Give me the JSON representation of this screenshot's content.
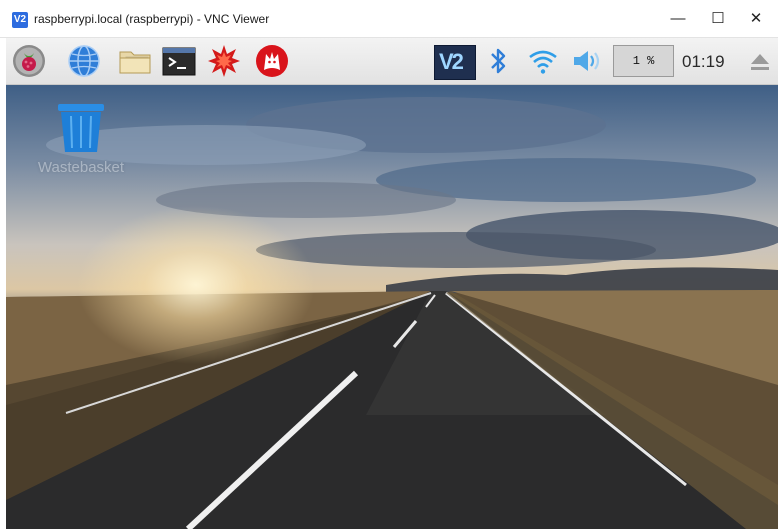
{
  "window": {
    "app_icon_label": "V2",
    "title": "raspberrypi.local (raspberrypi) - VNC Viewer",
    "minimize_label": "—",
    "maximize_label": "☐",
    "close_label": "✕"
  },
  "taskbar": {
    "launchers": [
      {
        "icon": "raspberry-menu-icon"
      },
      {
        "icon": "web-browser-icon"
      },
      {
        "icon": "file-manager-icon"
      },
      {
        "icon": "terminal-icon"
      },
      {
        "icon": "mathematica-icon"
      },
      {
        "icon": "wolfram-icon"
      }
    ],
    "tray": {
      "vnc_label": "V2",
      "cpu_usage": "1 %",
      "clock": "01:19"
    }
  },
  "desktop": {
    "trash_label": "Wastebasket"
  },
  "colors": {
    "taskbar_bg": "#ebebeb",
    "vnc_tray_bg": "#1f2f4f",
    "accent_blue": "#2f7ed8",
    "raspberry_red": "#c51a4a"
  }
}
